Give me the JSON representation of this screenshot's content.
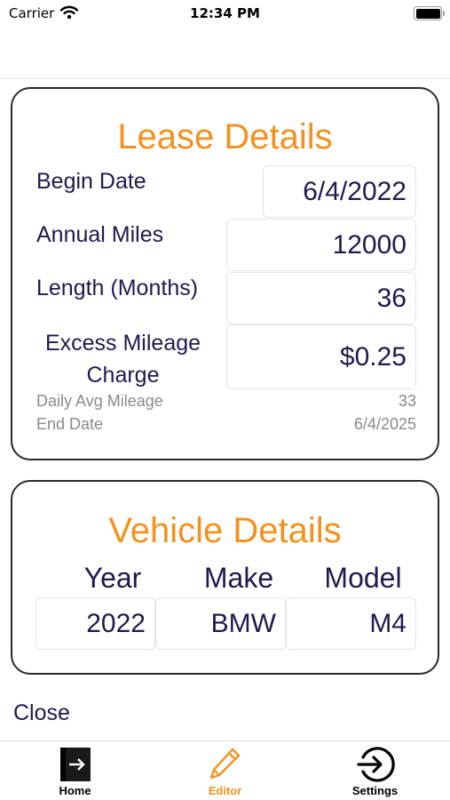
{
  "status_bar": {
    "carrier": "Carrier",
    "time": "12:34 PM"
  },
  "lease": {
    "title": "Lease Details",
    "begin_date_label": "Begin Date",
    "begin_date_value": "6/4/2022",
    "annual_miles_label": "Annual Miles",
    "annual_miles_value": "12000",
    "length_label": "Length (Months)",
    "length_value": "36",
    "excess_label_line1": "Excess Mileage",
    "excess_label_line2": "Charge",
    "excess_value": "$0.25",
    "daily_avg_label": "Daily Avg Mileage",
    "daily_avg_value": "33",
    "end_date_label": "End Date",
    "end_date_value": "6/4/2025"
  },
  "vehicle": {
    "title": "Vehicle Details",
    "year_label": "Year",
    "make_label": "Make",
    "model_label": "Model",
    "year_value": "2022",
    "make_value": "BMW",
    "model_value": "M4"
  },
  "close_label": "Close",
  "tabbar": {
    "tabs": [
      {
        "label": "Home",
        "icon": "door-exit-icon",
        "color": "#000000"
      },
      {
        "label": "Editor",
        "icon": "pencil-icon",
        "color": "#f5901e"
      },
      {
        "label": "Settings",
        "icon": "circle-arrow-icon",
        "color": "#000000"
      }
    ]
  },
  "colors": {
    "accent": "#f5901e",
    "text": "#1f1a4f",
    "muted": "#8a8a8a"
  }
}
